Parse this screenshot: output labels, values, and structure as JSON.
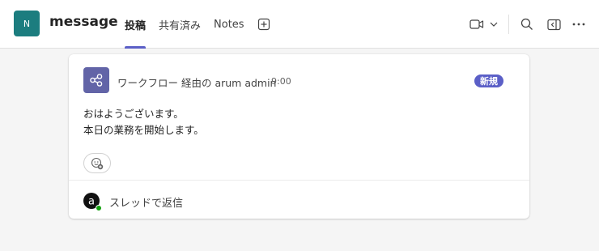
{
  "header": {
    "avatar_initial": "N",
    "avatar_color": "#1c7d7f",
    "title": "message",
    "tabs": [
      {
        "label": "投稿",
        "active": true
      },
      {
        "label": "共有済み",
        "active": false
      },
      {
        "label": "Notes",
        "active": false
      }
    ],
    "icons": {
      "add_tab": "plus-square-icon",
      "video": "video-camera-icon",
      "video_menu": "chevron-down-icon",
      "search": "search-icon",
      "panel": "side-panel-icon",
      "more": "more-horizontal-icon"
    }
  },
  "message": {
    "sender": "ワークフロー 経由の arum admin",
    "time": "9:00",
    "badge": "新規",
    "badge_color": "#5b5fc7",
    "icon_color": "#6264a7",
    "lines": [
      "おはようございます。",
      "本日の業務を開始します。"
    ]
  },
  "reply": {
    "label": "スレッドで返信",
    "presence_color": "#13a10e"
  },
  "colors": {
    "accent": "#5b5fc7"
  }
}
